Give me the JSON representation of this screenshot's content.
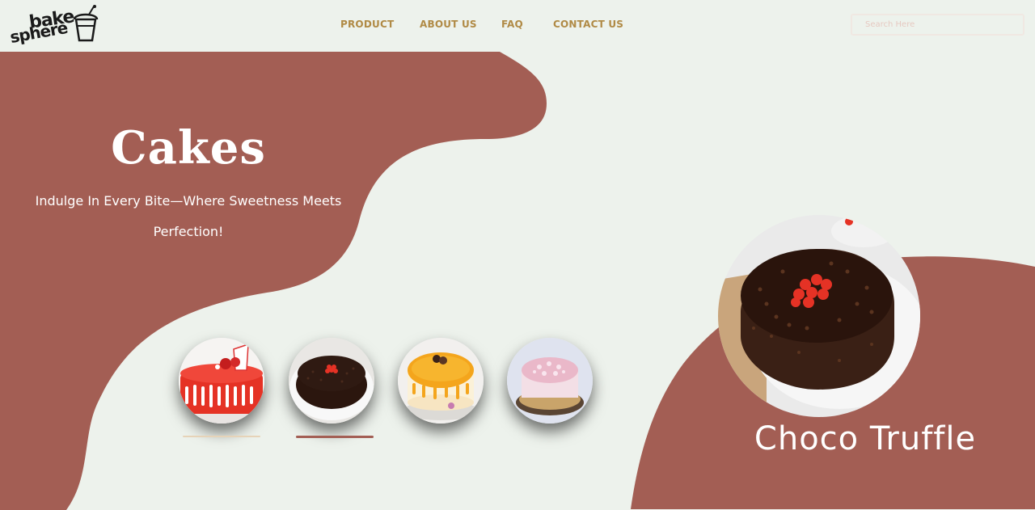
{
  "brand": {
    "logo_line1": "bake",
    "logo_line2": "sphere"
  },
  "nav": {
    "items": [
      {
        "label": "PRODUCT"
      },
      {
        "label": "ABOUT US"
      },
      {
        "label": "FAQ"
      },
      {
        "label": "CONTACT US"
      }
    ]
  },
  "search": {
    "placeholder": "Search Here",
    "value": ""
  },
  "hero": {
    "title": "Cakes",
    "subtitle": "Indulge In Every Bite—Where Sweetness Meets Perfection!"
  },
  "thumbnails": [
    {
      "name": "Red Velvet Drip Cake",
      "active": false
    },
    {
      "name": "Choco Truffle",
      "active": true
    },
    {
      "name": "Mango Cake",
      "active": false
    },
    {
      "name": "Pink Frosted Cake",
      "active": false
    }
  ],
  "featured": {
    "name": "Choco Truffle"
  },
  "colors": {
    "background": "#EDF2EC",
    "accent_brown": "#A35E54",
    "nav_text": "#B08A45",
    "underline_active": "#A35E54",
    "underline_inactive": "#E6D3B8"
  }
}
